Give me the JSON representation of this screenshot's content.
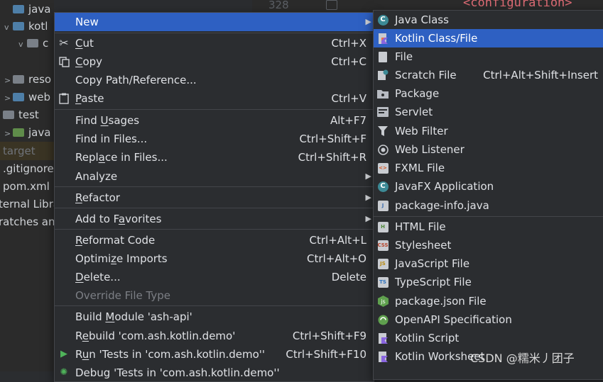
{
  "tree": {
    "rows": [
      {
        "label": "java",
        "chev": "",
        "folder": "blue"
      },
      {
        "label": "kotl",
        "chev": "v",
        "folder": "blue"
      },
      {
        "label": "c",
        "chev": "v",
        "folder": "grey"
      },
      {
        "label": "reso",
        "chev": ">",
        "folder": "grey"
      },
      {
        "label": "web",
        "chev": ">",
        "folder": "blue"
      },
      {
        "label": "test",
        "chev": "",
        "folder": "grey"
      },
      {
        "label": "java",
        "chev": ">",
        "folder": "green"
      },
      {
        "label": "target",
        "chev": "",
        "folder": ""
      },
      {
        "label": ".gitignore",
        "chev": "",
        "folder": ""
      },
      {
        "label": "pom.xml",
        "chev": "",
        "folder": ""
      },
      {
        "label": "ternal Libra",
        "chev": "",
        "folder": ""
      },
      {
        "label": "ratches and",
        "chev": "",
        "folder": ""
      }
    ]
  },
  "editor": {
    "line_number": "328",
    "config_tag": "<configuration>"
  },
  "context_menu": {
    "items": [
      {
        "label": "New",
        "shortcut": "",
        "arrow": true
      },
      {
        "label": "Cut",
        "shortcut": "Ctrl+X"
      },
      {
        "label": "Copy",
        "shortcut": "Ctrl+C"
      },
      {
        "label": "Copy Path/Reference...",
        "shortcut": ""
      },
      {
        "label": "Paste",
        "shortcut": "Ctrl+V"
      },
      {
        "label": "Find Usages",
        "shortcut": "Alt+F7"
      },
      {
        "label": "Find in Files...",
        "shortcut": "Ctrl+Shift+F"
      },
      {
        "label": "Replace in Files...",
        "shortcut": "Ctrl+Shift+R"
      },
      {
        "label": "Analyze",
        "shortcut": "",
        "arrow": true
      },
      {
        "label": "Refactor",
        "shortcut": "",
        "arrow": true
      },
      {
        "label": "Add to Favorites",
        "shortcut": "",
        "arrow": true
      },
      {
        "label": "Reformat Code",
        "shortcut": "Ctrl+Alt+L"
      },
      {
        "label": "Optimize Imports",
        "shortcut": "Ctrl+Alt+O"
      },
      {
        "label": "Delete...",
        "shortcut": "Delete"
      },
      {
        "label": "Override File Type",
        "shortcut": ""
      },
      {
        "label": "Build Module 'ash-api'",
        "shortcut": ""
      },
      {
        "label": "Rebuild 'com.ash.kotlin.demo'",
        "shortcut": "Ctrl+Shift+F9"
      },
      {
        "label": "Run 'Tests in 'com.ash.kotlin.demo''",
        "shortcut": "Ctrl+Shift+F10"
      },
      {
        "label": "Debug 'Tests in 'com.ash.kotlin.demo''",
        "shortcut": ""
      }
    ]
  },
  "submenu": {
    "items": [
      {
        "label": "Java Class",
        "shortcut": ""
      },
      {
        "label": "Kotlin Class/File",
        "shortcut": ""
      },
      {
        "label": "File",
        "shortcut": ""
      },
      {
        "label": "Scratch File",
        "shortcut": "Ctrl+Alt+Shift+Insert"
      },
      {
        "label": "Package",
        "shortcut": ""
      },
      {
        "label": "Servlet",
        "shortcut": ""
      },
      {
        "label": "Web Filter",
        "shortcut": ""
      },
      {
        "label": "Web Listener",
        "shortcut": ""
      },
      {
        "label": "FXML File",
        "shortcut": ""
      },
      {
        "label": "JavaFX Application",
        "shortcut": ""
      },
      {
        "label": "package-info.java",
        "shortcut": ""
      },
      {
        "label": "HTML File",
        "shortcut": ""
      },
      {
        "label": "Stylesheet",
        "shortcut": ""
      },
      {
        "label": "JavaScript File",
        "shortcut": ""
      },
      {
        "label": "TypeScript File",
        "shortcut": ""
      },
      {
        "label": "package.json File",
        "shortcut": ""
      },
      {
        "label": "OpenAPI Specification",
        "shortcut": ""
      },
      {
        "label": "Kotlin Script",
        "shortcut": ""
      },
      {
        "label": "Kotlin Worksheet",
        "shortcut": ""
      }
    ],
    "badges": {
      "css": "CSS",
      "js": "JS",
      "ts": "TS",
      "html": "H",
      "java": "J",
      "fxml": "<>"
    }
  },
  "watermark": "CSDN @糯米丿团子",
  "colors": {
    "selection": "#2e60c2",
    "menu_bg": "#2b2d30",
    "text": "#dfe1e5",
    "disabled": "#7c7f85"
  }
}
